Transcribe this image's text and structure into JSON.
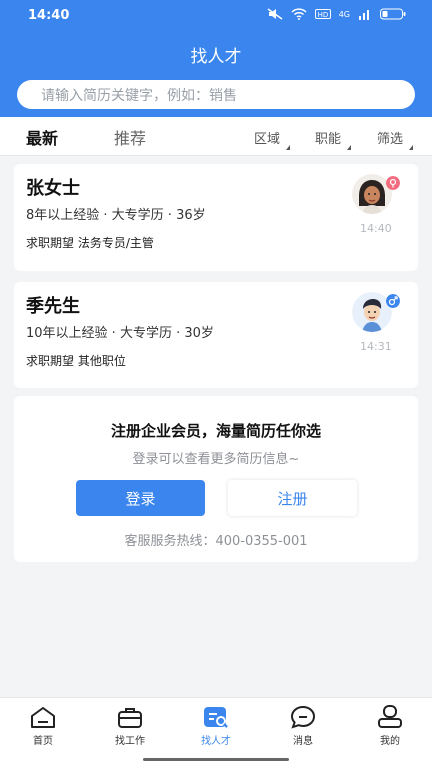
{
  "status_bar": {
    "time": "14:40",
    "network": "4G"
  },
  "header": {
    "title": "找人才"
  },
  "search": {
    "placeholder": "请输入简历关键字，例如：销售"
  },
  "tabs": [
    {
      "label": "最新",
      "active": true
    },
    {
      "label": "推荐",
      "active": false
    }
  ],
  "filters": [
    "区域",
    "职能",
    "筛选"
  ],
  "candidates": [
    {
      "name": "张女士",
      "info": "8年以上经验 · 大专学历 · 36岁",
      "want": "求职期望 法务专员/主管",
      "time": "14:40",
      "gender": "female",
      "gender_color": "#f36b7f"
    },
    {
      "name": "季先生",
      "info": "10年以上经验 · 大专学历 · 30岁",
      "want": "求职期望 其他职位",
      "time": "14:31",
      "gender": "male",
      "gender_color": "#3b86ee"
    }
  ],
  "login_prompt": {
    "title": "注册企业会员，海量简历任你选",
    "subtitle": "登录可以查看更多简历信息~",
    "login_label": "登录",
    "register_label": "注册",
    "hotline": "客服服务热线：400-0355-001"
  },
  "bottom_nav": [
    {
      "label": "首页",
      "icon": "home-icon"
    },
    {
      "label": "找工作",
      "icon": "briefcase-icon"
    },
    {
      "label": "找人才",
      "icon": "talent-search-icon",
      "active": true
    },
    {
      "label": "消息",
      "icon": "message-icon"
    },
    {
      "label": "我的",
      "icon": "profile-icon"
    }
  ],
  "colors": {
    "brand": "#3b86ee",
    "background": "#f3f4f6"
  }
}
